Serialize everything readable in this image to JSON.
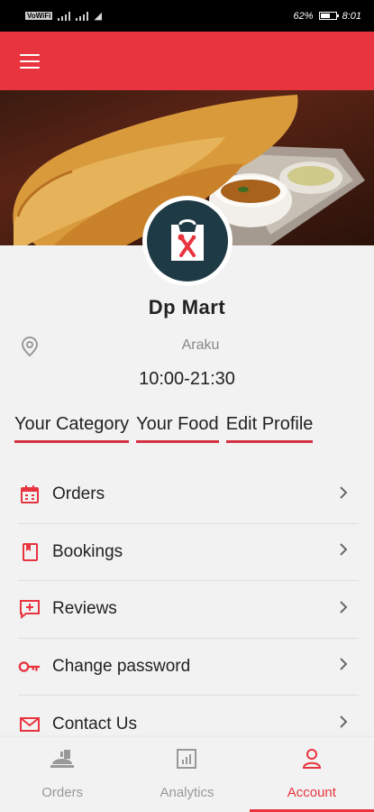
{
  "status_bar": {
    "left_text": "Wi-Fi",
    "battery": "62%",
    "time": "8:01"
  },
  "app_bar": {
    "menu_icon": "hamburger-icon"
  },
  "profile": {
    "name": "Dp Mart",
    "location": "Araku",
    "hours": "10:00-21:30"
  },
  "tabs": [
    {
      "label": "Your Category"
    },
    {
      "label": "Your Food"
    },
    {
      "label": "Edit Profile"
    }
  ],
  "menu": [
    {
      "label": "Orders",
      "icon": "calendar-icon"
    },
    {
      "label": "Bookings",
      "icon": "bookmark-icon"
    },
    {
      "label": "Reviews",
      "icon": "review-icon"
    },
    {
      "label": "Change password",
      "icon": "key-icon"
    },
    {
      "label": "Contact Us",
      "icon": "mail-icon"
    }
  ],
  "bottom_nav": [
    {
      "label": "Orders",
      "icon": "food-tray-icon",
      "active": false
    },
    {
      "label": "Analytics",
      "icon": "chart-icon",
      "active": false
    },
    {
      "label": "Account",
      "icon": "user-icon",
      "active": true
    }
  ],
  "colors": {
    "accent": "#e8343f",
    "avatar_bg": "#1e3a44"
  }
}
